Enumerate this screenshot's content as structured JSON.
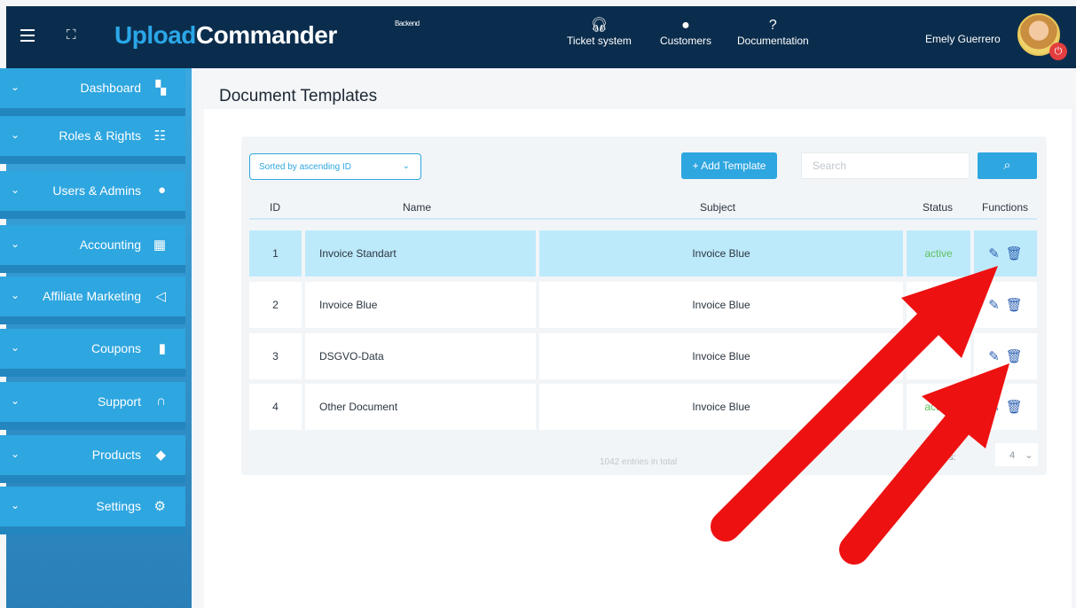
{
  "brand": {
    "upload": "Upload",
    "commander": "Commander",
    "tag": "Backend"
  },
  "topnav": [
    {
      "label": "Ticket system",
      "icon": "headset-icon"
    },
    {
      "label": "Customers",
      "icon": "user-circle-icon"
    },
    {
      "label": "Documentation",
      "icon": "help-circle-icon"
    }
  ],
  "user": {
    "name": "Emely Guerrero"
  },
  "sidebar": {
    "items": [
      {
        "label": "Dashboard",
        "icon": "dashboard-icon"
      },
      {
        "label": "Roles & Rights",
        "icon": "roles-icon"
      },
      {
        "label": "Users & Admins",
        "icon": "user-icon"
      },
      {
        "label": "Accounting",
        "icon": "calculator-icon"
      },
      {
        "label": "Affiliate Marketing",
        "icon": "megaphone-icon"
      },
      {
        "label": "Coupons",
        "icon": "coupon-icon"
      },
      {
        "label": "Support",
        "icon": "headset-icon"
      },
      {
        "label": "Products",
        "icon": "box-icon"
      },
      {
        "label": "Settings",
        "icon": "gear-icon"
      }
    ]
  },
  "page": {
    "title": "Document Templates"
  },
  "toolbar": {
    "sort_label": "Sorted by ascending ID",
    "add_label": "+ Add Template",
    "search_placeholder": "Search"
  },
  "table": {
    "headers": {
      "id": "ID",
      "name": "Name",
      "subject": "Subject",
      "status": "Status",
      "functions": "Functions"
    },
    "rows": [
      {
        "id": "1",
        "name": "Invoice Standart",
        "subject": "Invoice Blue",
        "status": "active"
      },
      {
        "id": "2",
        "name": "Invoice Blue",
        "subject": "Invoice Blue",
        "status": ""
      },
      {
        "id": "3",
        "name": "DSGVO-Data",
        "subject": "Invoice Blue",
        "status": ""
      },
      {
        "id": "4",
        "name": "Other Document",
        "subject": "Invoice Blue",
        "status": "active"
      }
    ]
  },
  "footer": {
    "total": "1042 entries in total",
    "per_page_label": "ies:",
    "per_page_value": "4"
  },
  "colors": {
    "topbar": "#0b2d4d",
    "accent": "#2ea6e0",
    "highlight": "#bdeafb",
    "annotation_arrow": "#ee1111"
  }
}
